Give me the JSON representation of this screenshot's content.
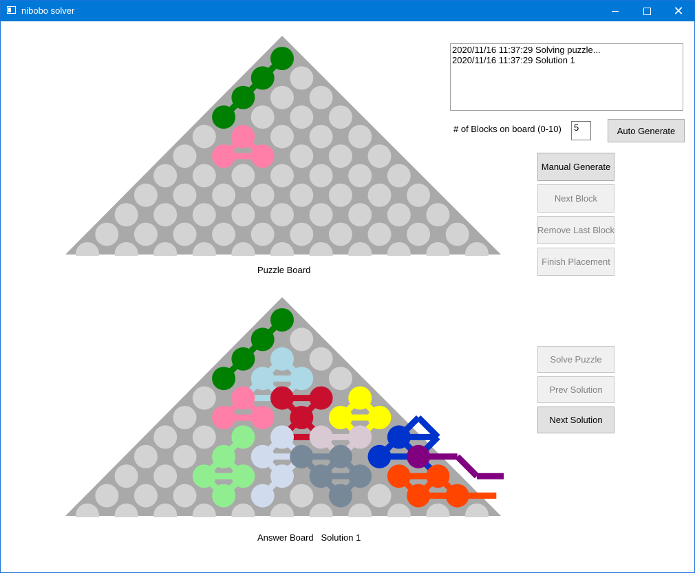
{
  "window": {
    "title": "nibobo solver"
  },
  "log": {
    "lines": [
      "2020/11/16 11:37:29 Solving puzzle...",
      "2020/11/16 11:37:29 Solution 1"
    ]
  },
  "controls": {
    "blocks_label": "# of Blocks on board (0-10)",
    "blocks_value": "5",
    "auto_generate": "Auto Generate",
    "manual_generate": "Manual Generate",
    "next_block": "Next Block",
    "remove_last_block": "Remove Last Block",
    "finish_placement": "Finish Placement",
    "solve_puzzle": "Solve Puzzle",
    "prev_solution": "Prev Solution",
    "next_solution": "Next Solution"
  },
  "boards": {
    "puzzle_label": "Puzzle Board",
    "answer_label": "Answer Board   Solution 1",
    "board_color": "#a9a9a9",
    "empty_color": "#d3d3d3",
    "puzzle_pieces": [
      {
        "color": "#008000",
        "cells": [
          [
            0,
            0
          ],
          [
            1,
            0
          ],
          [
            2,
            0
          ],
          [
            3,
            0
          ]
        ]
      },
      {
        "color": "#ff7fa8",
        "cells": [
          [
            4,
            1
          ],
          [
            5,
            1
          ],
          [
            5,
            2
          ]
        ]
      }
    ],
    "answer_pieces": [
      {
        "color": "#008000",
        "cells": [
          [
            0,
            0
          ],
          [
            1,
            0
          ],
          [
            2,
            0
          ],
          [
            3,
            0
          ]
        ]
      },
      {
        "color": "#add8e6",
        "cells": [
          [
            2,
            1
          ],
          [
            3,
            1
          ],
          [
            3,
            2
          ],
          [
            4,
            1
          ],
          [
            4,
            2
          ]
        ]
      },
      {
        "color": "#ff7fa8",
        "cells": [
          [
            4,
            1
          ],
          [
            5,
            1
          ],
          [
            5,
            2
          ]
        ]
      },
      {
        "color": "#c8102e",
        "cells": [
          [
            4,
            2
          ],
          [
            4,
            3
          ],
          [
            5,
            3
          ],
          [
            6,
            3
          ],
          [
            6,
            4
          ]
        ]
      },
      {
        "color": "#ffff00",
        "cells": [
          [
            4,
            4
          ],
          [
            5,
            4
          ],
          [
            5,
            5
          ],
          [
            6,
            5
          ]
        ]
      },
      {
        "color": "#d9c9d3",
        "cells": [
          [
            6,
            4
          ],
          [
            6,
            5
          ],
          [
            7,
            5
          ],
          [
            8,
            5
          ],
          [
            8,
            6
          ]
        ]
      },
      {
        "color": "#0033cc",
        "cells": [
          [
            5,
            6
          ],
          [
            6,
            6
          ],
          [
            6,
            7
          ],
          [
            7,
            6
          ],
          [
            7,
            7
          ],
          [
            8,
            8
          ]
        ]
      },
      {
        "color": "#800080",
        "cells": [
          [
            7,
            7
          ],
          [
            7,
            8
          ],
          [
            8,
            9
          ],
          [
            8,
            10
          ],
          [
            9,
            11
          ]
        ]
      },
      {
        "color": "#90ee90",
        "cells": [
          [
            6,
            2
          ],
          [
            7,
            2
          ],
          [
            8,
            2
          ],
          [
            8,
            3
          ],
          [
            9,
            3
          ]
        ]
      },
      {
        "color": "#d0dcee",
        "cells": [
          [
            6,
            3
          ],
          [
            7,
            3
          ],
          [
            7,
            4
          ],
          [
            8,
            4
          ],
          [
            9,
            4
          ]
        ]
      },
      {
        "color": "#778899",
        "cells": [
          [
            7,
            4
          ],
          [
            7,
            5
          ],
          [
            8,
            5
          ],
          [
            8,
            6
          ],
          [
            9,
            6
          ]
        ]
      },
      {
        "color": "#ff4500",
        "cells": [
          [
            8,
            7
          ],
          [
            8,
            8
          ],
          [
            9,
            8
          ],
          [
            9,
            9
          ],
          [
            9,
            10
          ]
        ]
      }
    ]
  }
}
